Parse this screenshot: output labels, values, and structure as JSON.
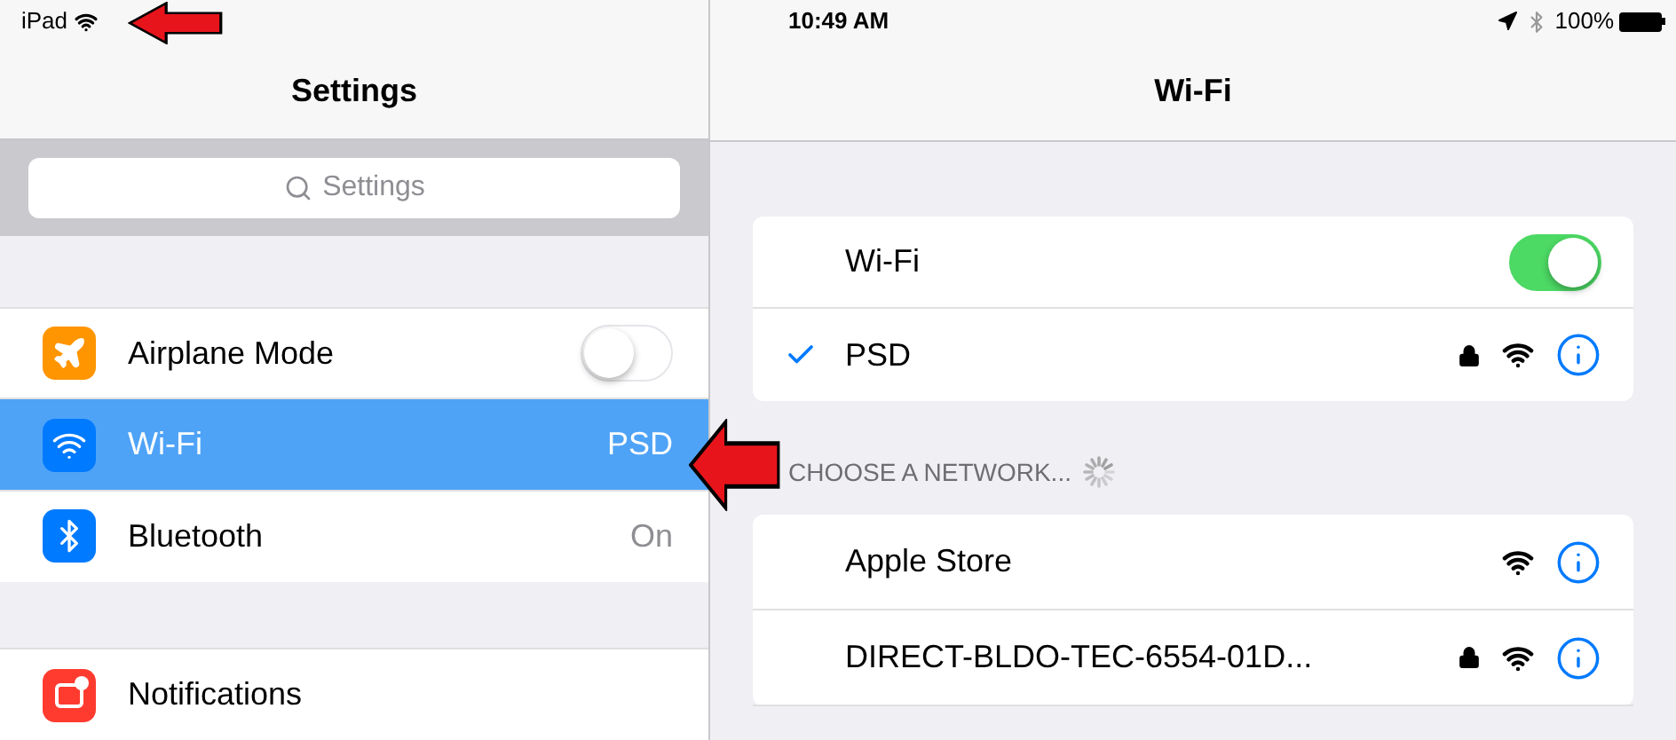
{
  "status_bar": {
    "device": "iPad",
    "time": "10:49 AM",
    "battery": "100%"
  },
  "sidebar": {
    "title": "Settings",
    "search": {
      "placeholder": "Settings"
    },
    "items": [
      {
        "label": "Airplane Mode",
        "kind": "toggle",
        "on": false,
        "selected": false
      },
      {
        "label": "Wi-Fi",
        "kind": "value",
        "value": "PSD",
        "selected": true
      },
      {
        "label": "Bluetooth",
        "kind": "value",
        "value": "On",
        "selected": false
      },
      {
        "label": "Notifications",
        "kind": "plain",
        "selected": false
      }
    ]
  },
  "detail": {
    "title": "Wi-Fi",
    "wifi_toggle": {
      "label": "Wi-Fi",
      "on": true
    },
    "connected": {
      "name": "PSD",
      "checked": true,
      "locked": true
    },
    "section_header": "CHOOSE A NETWORK...",
    "networks": [
      {
        "name": "Apple Store",
        "locked": false
      },
      {
        "name": "DIRECT-BLDO-TEC-6554-01D...",
        "locked": true
      }
    ]
  }
}
